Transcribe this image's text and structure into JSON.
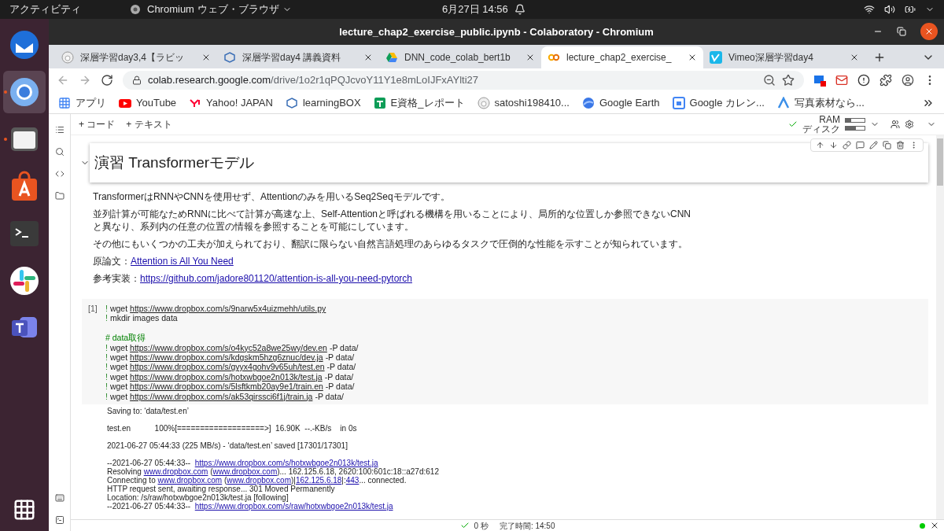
{
  "topbar": {
    "activities": "アクティビティ",
    "app_menu": "Chromium ウェブ・ブラウザ",
    "clock": "6月27日 14:56"
  },
  "dock": [
    {
      "selected": false,
      "running": false
    },
    {
      "selected": true,
      "running": true
    },
    {
      "selected": false,
      "running": true
    },
    {
      "selected": false,
      "running": false
    },
    {
      "selected": false,
      "running": false
    },
    {
      "selected": false,
      "running": false
    },
    {
      "selected": false,
      "running": false
    }
  ],
  "window": {
    "title": "lecture_chap2_exercise_public.ipynb - Colaboratory - Chromium"
  },
  "tabs": [
    {
      "label": "深層学習day3,4【ラビッ",
      "selected": false
    },
    {
      "label": "深層学習day4 講義資料",
      "selected": false
    },
    {
      "label": "DNN_code_colab_bert1b",
      "selected": false
    },
    {
      "label": "lecture_chap2_exercise_",
      "selected": true
    },
    {
      "label": "Vimeo深層学習day4",
      "selected": false
    }
  ],
  "address": {
    "host": "colab.research.google.com",
    "path": "/drive/1o2r1qPQJcvoY11Y1e8mLoIJFxAYlti27"
  },
  "bookmarks": [
    "アプリ",
    "YouTube",
    "Yahoo! JAPAN",
    "learningBOX",
    "E資格_レポート",
    "satoshi198410...",
    "Google Earth",
    "Google カレン...",
    "写真素材なら..."
  ],
  "colab_toolbar": {
    "add_code": "+ コード",
    "add_text": "+ テキスト",
    "ram": {
      "label": "RAM",
      "level": 0.3
    },
    "disk": {
      "label": "ディスク",
      "level": 0.55
    }
  },
  "heading": "演習 Transformerモデル",
  "paragraphs": [
    {
      "text": "TransformerはRNNやCNNを使用せず、Attentionのみを用いるSeq2Seqモデルです。"
    },
    {
      "text": "並列計算が可能なためRNNに比べて計算が高速な上、Self-Attentionと呼ばれる機構を用いることにより、局所的な位置しか参照できないCNNと異なり、系列内の任意の位置の情報を参照することを可能にしています。"
    },
    {
      "text": "その他にもいくつかの工夫が加えられており、翻訳に限らない自然言語処理のあらゆるタスクで圧倒的な性能を示すことが知られています。"
    },
    {
      "text": "原論文：",
      "link": "Attention is All You Need"
    },
    {
      "text": "参考実装：",
      "link": "https://github.com/jadore801120/attention-is-all-you-need-pytorch"
    }
  ],
  "code_cell": {
    "count": "[1]",
    "lines": [
      {
        "kind": "command",
        "bang": "!",
        "command": "wget",
        "url": "https://www.dropbox.com/s/9narw5x4uizmehh/utils.py"
      },
      {
        "kind": "command",
        "bang": "!",
        "command": "mkdir images data"
      },
      {
        "kind": "blank"
      },
      {
        "kind": "comment",
        "text": "# data取得"
      },
      {
        "kind": "command",
        "bang": "!",
        "command": "wget",
        "url": "https://www.dropbox.com/s/o4kyc52a8we25wy/dev.en",
        "args": "-P data/"
      },
      {
        "kind": "command",
        "bang": "!",
        "command": "wget",
        "url": "https://www.dropbox.com/s/kdgskm5hzg6znuc/dev.ja",
        "args": "-P data/"
      },
      {
        "kind": "command",
        "bang": "!",
        "command": "wget",
        "url": "https://www.dropbox.com/s/gyyx4gohv9v65uh/test.en",
        "args": "-P data/"
      },
      {
        "kind": "command",
        "bang": "!",
        "command": "wget",
        "url": "https://www.dropbox.com/s/hotxwbgoe2n013k/test.ja",
        "args": "-P data/"
      },
      {
        "kind": "command",
        "bang": "!",
        "command": "wget",
        "url": "https://www.dropbox.com/s/5lsftkmb20ay9e1/train.en",
        "args": "-P data/"
      },
      {
        "kind": "command",
        "bang": "!",
        "command": "wget",
        "url": "https://www.dropbox.com/s/ak53qirssci6f1j/train.ja",
        "args": "-P data/"
      }
    ]
  },
  "output": [
    {
      "kind": "text",
      "parts": [
        {
          "text": "Saving to: ‘data/test.en’",
          "link": false
        }
      ]
    },
    {
      "kind": "blank"
    },
    {
      "kind": "text",
      "parts": [
        {
          "text": "test.en           100%[===================>]  16.90K  --.-KB/s    in 0s",
          "link": false
        }
      ]
    },
    {
      "kind": "blank"
    },
    {
      "kind": "text",
      "parts": [
        {
          "text": "2021-06-27 05:44:33 (225 MB/s) - ‘data/test.en’ saved [17301/17301]",
          "link": false
        }
      ]
    },
    {
      "kind": "blank"
    },
    {
      "kind": "text",
      "parts": [
        {
          "text": "--2021-06-27 05:44:33--  ",
          "link": false
        },
        {
          "text": "https://www.dropbox.com/s/hotxwbgoe2n013k/test.ja",
          "link": true
        }
      ]
    },
    {
      "kind": "text",
      "parts": [
        {
          "text": "Resolving ",
          "link": false
        },
        {
          "text": "www.dropbox.com",
          "link": true
        },
        {
          "text": " (",
          "link": false
        },
        {
          "text": "www.dropbox.com",
          "link": true
        },
        {
          "text": ")... 162.125.6.18, 2620:100:601c:18::a27d:612",
          "link": false
        }
      ]
    },
    {
      "kind": "text",
      "parts": [
        {
          "text": "Connecting to ",
          "link": false
        },
        {
          "text": "www.dropbox.com",
          "link": true
        },
        {
          "text": " (",
          "link": false
        },
        {
          "text": "www.dropbox.com",
          "link": true
        },
        {
          "text": ")|",
          "link": false
        },
        {
          "text": "162.125.6.18",
          "link": true
        },
        {
          "text": "|:",
          "link": false
        },
        {
          "text": "443",
          "link": true
        },
        {
          "text": "... connected.",
          "link": false
        }
      ]
    },
    {
      "kind": "text",
      "parts": [
        {
          "text": "HTTP request sent, awaiting response... 301 Moved Permanently",
          "link": false
        }
      ]
    },
    {
      "kind": "text",
      "parts": [
        {
          "text": "Location: /s/raw/hotxwbgoe2n013k/test.ja [following]",
          "link": false
        }
      ]
    },
    {
      "kind": "text",
      "parts": [
        {
          "text": "--2021-06-27 05:44:33--  ",
          "link": false
        },
        {
          "text": "https://www.dropbox.com/s/raw/hotxwbgoe2n013k/test.ja",
          "link": true
        }
      ]
    }
  ],
  "status_bar": {
    "elapsed": "0 秒",
    "finished": "完了時間: 14:50"
  }
}
